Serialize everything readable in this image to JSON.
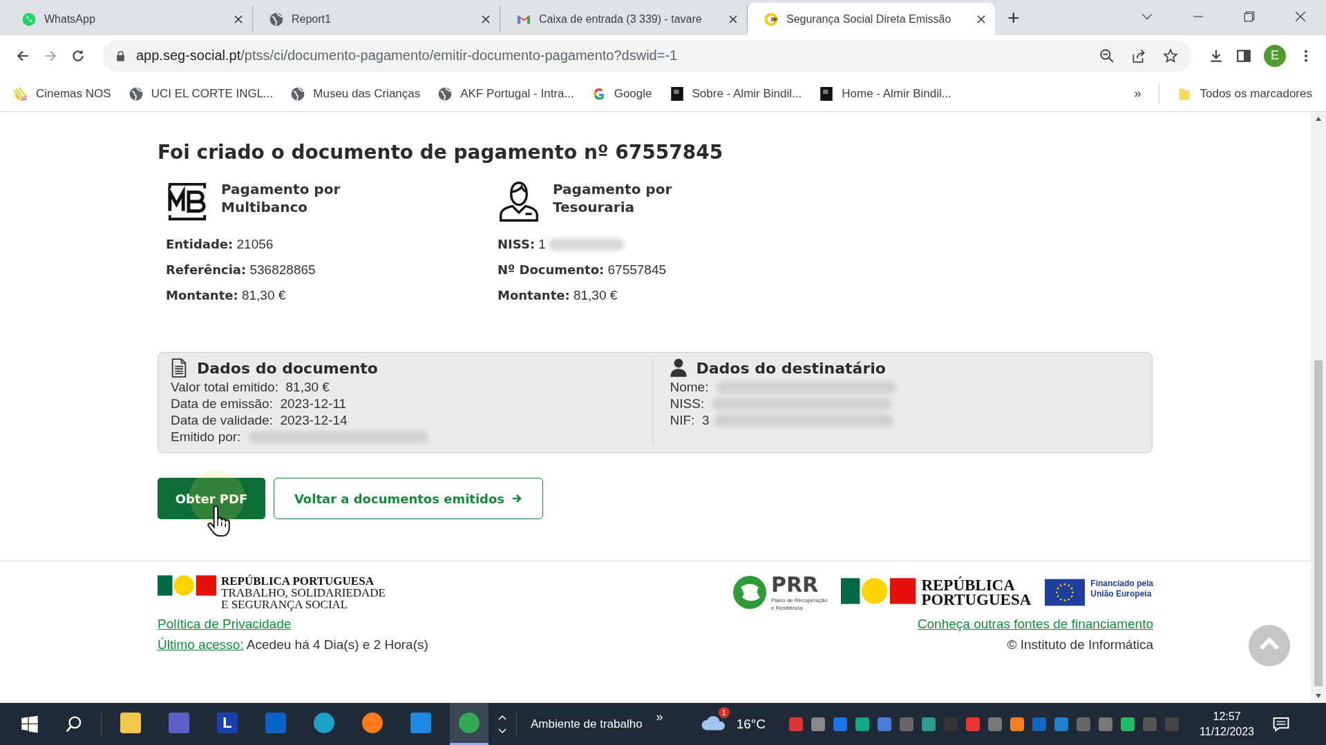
{
  "browser": {
    "tabs": [
      {
        "title": "WhatsApp",
        "kind": "whatsapp",
        "selected": false
      },
      {
        "title": "Report1",
        "kind": "globe",
        "selected": false
      },
      {
        "title": "Caixa de entrada (3 339) - tavare",
        "kind": "gmail",
        "selected": false
      },
      {
        "title": "Segurança Social Direta Emissão",
        "kind": "segsocial",
        "selected": true
      }
    ],
    "new_tab": "+",
    "address": {
      "domain": "app.seg-social.pt",
      "path": "/ptss/ci/documento-pagamento/emitir-documento-pagamento?dswid=-1"
    },
    "profile_initial": "E",
    "bookmarks": [
      {
        "label": "Cinemas NOS",
        "kind": "stripes"
      },
      {
        "label": "UCI EL CORTE INGL...",
        "kind": "globe"
      },
      {
        "label": "Museu das Crianças",
        "kind": "globe"
      },
      {
        "label": "AKF Portugal - Intra...",
        "kind": "globe"
      },
      {
        "label": "Google",
        "kind": "google"
      },
      {
        "label": "Sobre - Almir Bindil...",
        "kind": "dark"
      },
      {
        "label": "Home - Almir Bindil...",
        "kind": "dark"
      }
    ],
    "bookmarks_overflow": "»",
    "all_bookmarks": "Todos os marcadores"
  },
  "page": {
    "heading": "Foi criado o documento de pagamento nº 67557845",
    "payment_methods": [
      {
        "kind": "multibanco",
        "title_line1": "Pagamento por",
        "title_line2": "Multibanco",
        "fields": [
          {
            "label": "Entidade:",
            "value": "21056",
            "redacted": false
          },
          {
            "label": "Referência:",
            "value": "536828865",
            "redacted": false
          },
          {
            "label": "Montante:",
            "value": "81,30 €",
            "redacted": false
          }
        ]
      },
      {
        "kind": "tesouraria",
        "title_line1": "Pagamento por",
        "title_line2": "Tesouraria",
        "fields": [
          {
            "label": "NISS:",
            "value": "1",
            "redacted": true
          },
          {
            "label": "Nº Documento:",
            "value": "67557845",
            "redacted": false
          },
          {
            "label": "Montante:",
            "value": "81,30 €",
            "redacted": false
          }
        ]
      }
    ],
    "details": [
      {
        "kind": "document",
        "title": "Dados do documento",
        "fields": [
          {
            "label": "Valor total emitido:",
            "value": "81,30 €",
            "redacted": false
          },
          {
            "label": "Data de emissão:",
            "value": "2023-12-11",
            "redacted": false
          },
          {
            "label": "Data de validade:",
            "value": "2023-12-14",
            "redacted": false
          },
          {
            "label": "Emitido por:",
            "redacted": true
          }
        ]
      },
      {
        "kind": "person",
        "title": "Dados do destinatário",
        "fields": [
          {
            "label": "Nome:",
            "redacted": true
          },
          {
            "label": "NISS:",
            "redacted": true
          },
          {
            "label": "NIF:",
            "value": "3",
            "redacted": true
          }
        ]
      }
    ],
    "primary_button": "Obter PDF",
    "secondary_button": "Voltar a documentos emitidos",
    "footer": {
      "left_logo": [
        "REPÚBLICA PORTUGUESA",
        "TRABALHO, SOLIDARIEDADE",
        "E SEGURANÇA SOCIAL"
      ],
      "prr": {
        "title": "PRR",
        "subtitle_lines": [
          "Plano de Recuperação",
          "e Resiliência"
        ]
      },
      "right_logo": [
        "REPÚBLICA",
        "PORTUGUESA"
      ],
      "eu": [
        "Financiado pela",
        "União Europeia"
      ],
      "privacy_link": "Política de Privacidade",
      "last_access_link": "Último acesso:",
      "last_access_text": "Acedeu há 4 Dia(s) e 2 Hora(s)",
      "funding_link": "Conheça outras fontes de financiamento",
      "copyright": "© Instituto de Informática"
    }
  },
  "taskbar": {
    "apps": [
      {
        "kind": "explorer",
        "selected": false
      },
      {
        "kind": "teams",
        "selected": false
      },
      {
        "kind": "l",
        "label": "L",
        "selected": false
      },
      {
        "kind": "outlook",
        "selected": false
      },
      {
        "kind": "edge",
        "selected": false
      },
      {
        "kind": "firefox",
        "selected": false
      },
      {
        "kind": "mail",
        "selected": false
      },
      {
        "kind": "chrome",
        "selected": true
      }
    ],
    "desktop_label": "Ambiente de trabalho",
    "desktop_more": "»",
    "weather_badge": "1",
    "temperature": "16°C",
    "time": "12:57",
    "date": "11/12/2023"
  }
}
